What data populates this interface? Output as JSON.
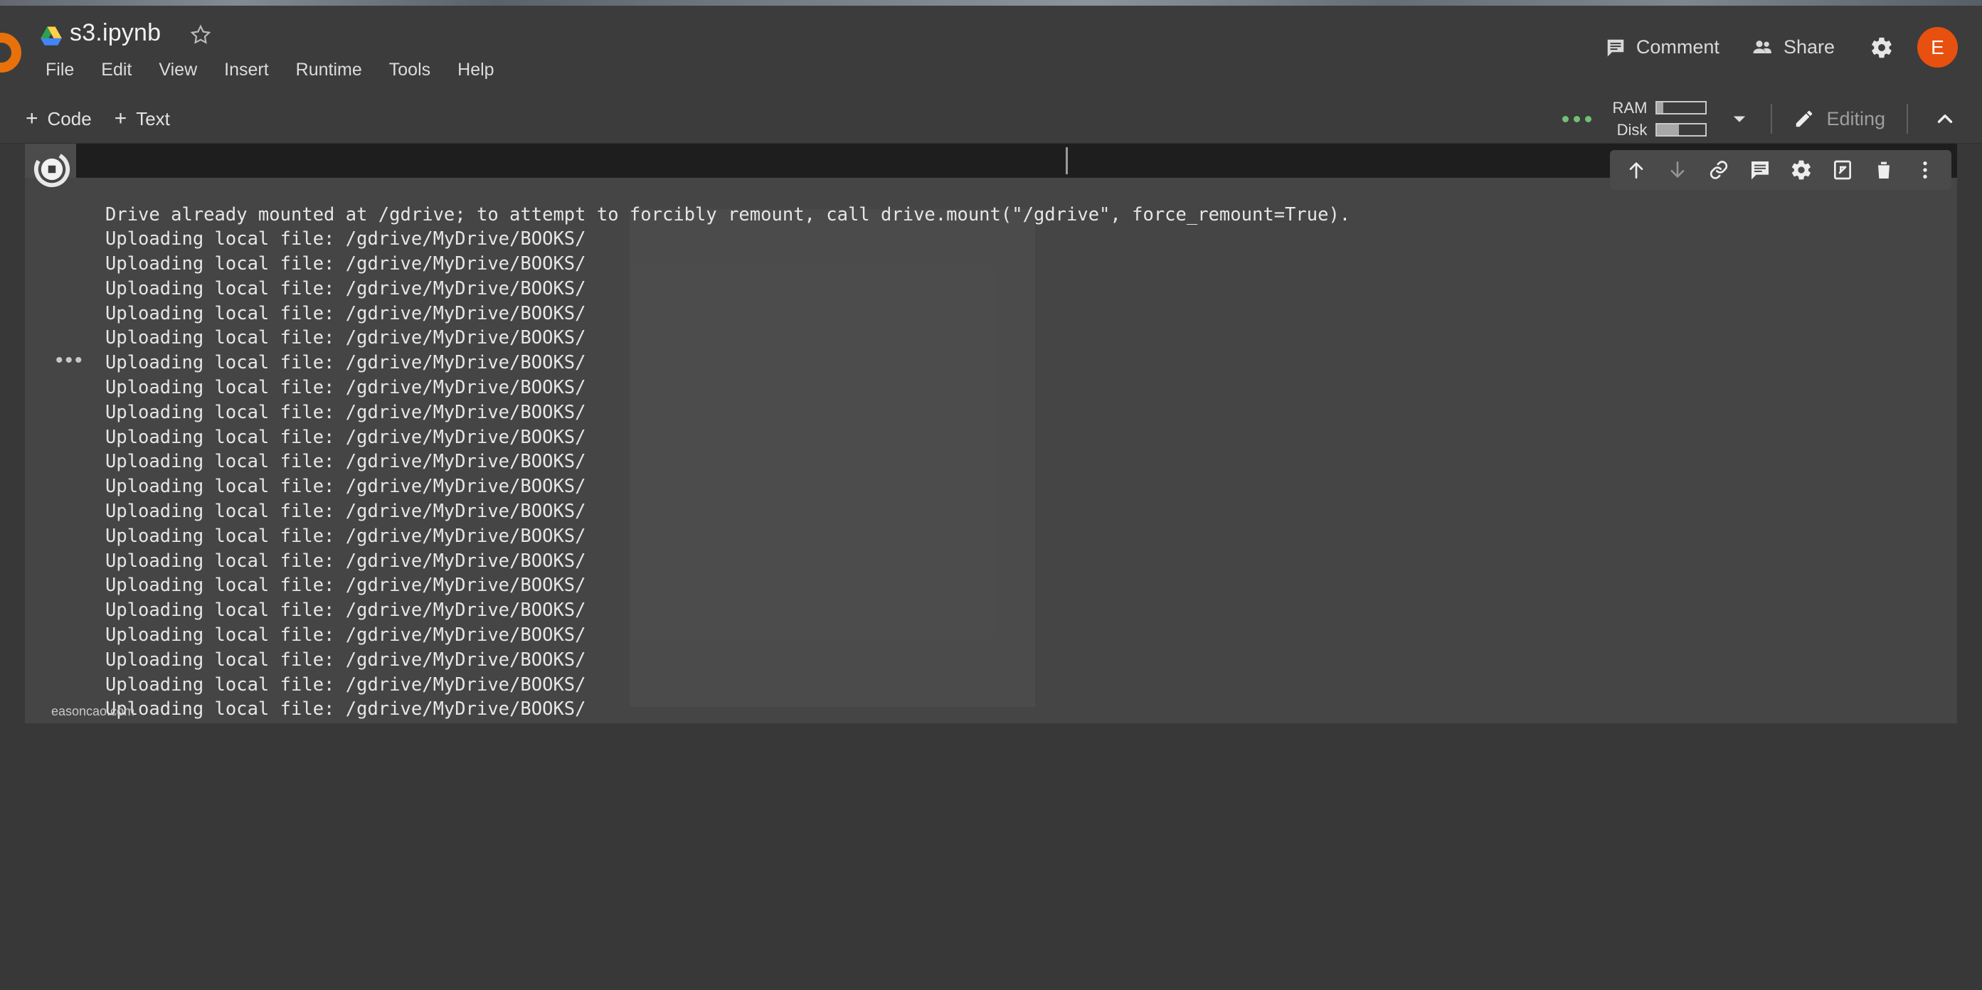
{
  "app": {
    "name": "Google Colaboratory",
    "logo_color": "#e8710a"
  },
  "header": {
    "drive_icon": "google-drive-icon",
    "file_title": "s3.ipynb",
    "star_icon": "star-outline-icon",
    "menus": [
      "File",
      "Edit",
      "View",
      "Insert",
      "Runtime",
      "Tools",
      "Help"
    ],
    "comment_label": "Comment",
    "comment_icon": "comment-icon",
    "share_label": "Share",
    "share_icon": "people-icon",
    "settings_icon": "gear-icon",
    "avatar_initial": "E",
    "avatar_color": "#e8500f"
  },
  "toolbar": {
    "add_code_label": "Code",
    "add_text_label": "Text",
    "plus_glyph": "+",
    "connection_dots_icon": "green-dots-icon",
    "ram_label": "RAM",
    "ram_fill_percent": 12,
    "disk_label": "Disk",
    "disk_fill_percent": 45,
    "caret_down_icon": "chevron-down-icon",
    "editing_label": "Editing",
    "editing_icon": "pencil-icon",
    "collapse_icon": "chevron-up-icon"
  },
  "cell": {
    "run_button_icon": "stop-running-icon",
    "more_options_icon": "ellipsis-icon",
    "toolbar_icons": [
      {
        "name": "move-cell-up-icon",
        "glyph": "arrow-up",
        "dim": false
      },
      {
        "name": "move-cell-down-icon",
        "glyph": "arrow-down",
        "dim": true
      },
      {
        "name": "link-to-cell-icon",
        "glyph": "link",
        "dim": false
      },
      {
        "name": "add-comment-icon",
        "glyph": "comment",
        "dim": false
      },
      {
        "name": "cell-settings-icon",
        "glyph": "gear",
        "dim": false
      },
      {
        "name": "mirror-cell-icon",
        "glyph": "mirror",
        "dim": false
      },
      {
        "name": "delete-cell-icon",
        "glyph": "trash",
        "dim": false
      },
      {
        "name": "cell-more-icon",
        "glyph": "kebab",
        "dim": false
      }
    ],
    "output_text": "Drive already mounted at /gdrive; to attempt to forcibly remount, call drive.mount(\"/gdrive\", force_remount=True).\nUploading local file: /gdrive/MyDrive/BOOKS/\nUploading local file: /gdrive/MyDrive/BOOKS/\nUploading local file: /gdrive/MyDrive/BOOKS/\nUploading local file: /gdrive/MyDrive/BOOKS/\nUploading local file: /gdrive/MyDrive/BOOKS/\nUploading local file: /gdrive/MyDrive/BOOKS/\nUploading local file: /gdrive/MyDrive/BOOKS/\nUploading local file: /gdrive/MyDrive/BOOKS/\nUploading local file: /gdrive/MyDrive/BOOKS/\nUploading local file: /gdrive/MyDrive/BOOKS/\nUploading local file: /gdrive/MyDrive/BOOKS/\nUploading local file: /gdrive/MyDrive/BOOKS/\nUploading local file: /gdrive/MyDrive/BOOKS/\nUploading local file: /gdrive/MyDrive/BOOKS/\nUploading local file: /gdrive/MyDrive/BOOKS/\nUploading local file: /gdrive/MyDrive/BOOKS/\nUploading local file: /gdrive/MyDrive/BOOKS/\nUploading local file: /gdrive/MyDrive/BOOKS/\nUploading local file: /gdrive/MyDrive/BOOKS/\nUploading local file: /gdrive/MyDrive/BOOKS/\nUploading local file: /gdrive/MyDrive/BOOKS/",
    "watermark": "easoncao.com"
  }
}
